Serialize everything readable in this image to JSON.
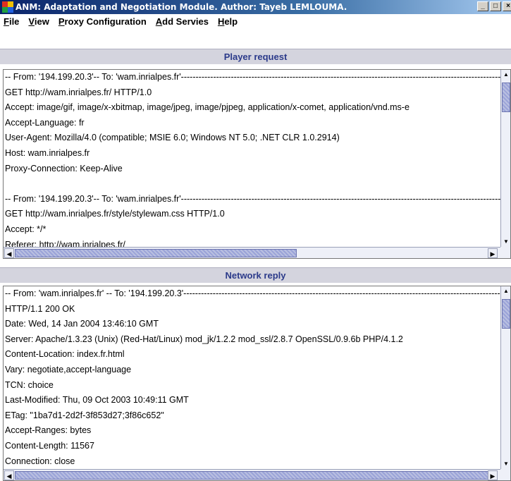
{
  "window": {
    "title": "ANM: Adaptation and Negotiation Module. Author: Tayeb LEMLOUMA.",
    "minimize": "_",
    "maximize": "□",
    "close": "×"
  },
  "menu": {
    "file": "File",
    "view": "View",
    "proxy_config": "Proxy Configuration",
    "add_services": "Add Servies",
    "help": "Help"
  },
  "player_request": {
    "header": "Player request",
    "lines": [
      "-- From: '194.199.20.3'-- To: 'wam.inrialpes.fr'---------------------------------------------------------------------------------------------------------------------------------------",
      "GET http://wam.inrialpes.fr/ HTTP/1.0",
      "Accept: image/gif, image/x-xbitmap, image/jpeg, image/pjpeg, application/x-comet, application/vnd.ms-e",
      "Accept-Language: fr",
      "User-Agent: Mozilla/4.0 (compatible; MSIE 6.0; Windows NT 5.0; .NET CLR 1.0.2914)",
      "Host: wam.inrialpes.fr",
      "Proxy-Connection: Keep-Alive",
      "",
      "-- From: '194.199.20.3'-- To: 'wam.inrialpes.fr'---------------------------------------------------------------------------------------------------------------------------------------",
      "GET http://wam.inrialpes.fr/style/stylewam.css HTTP/1.0",
      "Accept: */*",
      "Referer: http://wam.inrialpes.fr/"
    ]
  },
  "network_reply": {
    "header": "Network reply",
    "lines": [
      "-- From: 'wam.inrialpes.fr' -- To: '194.199.20.3'---------------------------------------------------------------------------------------------------------------------------------------",
      "HTTP/1.1 200 OK",
      "Date: Wed, 14 Jan 2004 13:46:10 GMT",
      "Server: Apache/1.3.23 (Unix)  (Red-Hat/Linux) mod_jk/1.2.2 mod_ssl/2.8.7 OpenSSL/0.9.6b PHP/4.1.2",
      "Content-Location: index.fr.html",
      "Vary: negotiate,accept-language",
      "TCN: choice",
      "Last-Modified: Thu, 09 Oct 2003 10:49:11 GMT",
      "ETag: \"1ba7d1-2d2f-3f853d27;3f86c652\"",
      "Accept-Ranges: bytes",
      "Content-Length: 11567",
      "Connection: close"
    ]
  },
  "icons": {
    "app": "app-icon",
    "up": "▲",
    "down": "▼",
    "left": "◀",
    "right": "▶"
  },
  "colors": {
    "titlebar_start": "#0a246a",
    "section_header_text": "#2b3a8a",
    "section_header_bg": "#d4d4de"
  }
}
